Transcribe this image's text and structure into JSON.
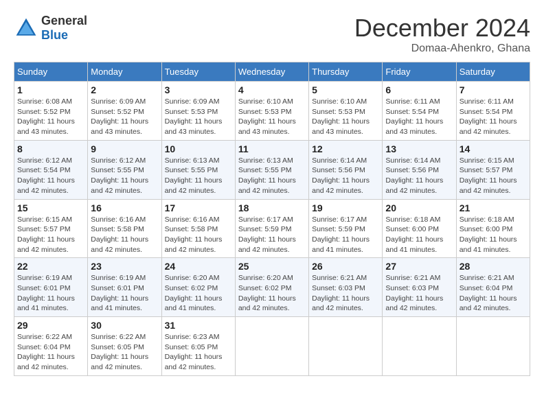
{
  "logo": {
    "general": "General",
    "blue": "Blue"
  },
  "title": "December 2024",
  "location": "Domaa-Ahenkro, Ghana",
  "days_of_week": [
    "Sunday",
    "Monday",
    "Tuesday",
    "Wednesday",
    "Thursday",
    "Friday",
    "Saturday"
  ],
  "weeks": [
    [
      {
        "day": "1",
        "sunrise": "6:08 AM",
        "sunset": "5:52 PM",
        "daylight": "11 hours and 43 minutes."
      },
      {
        "day": "2",
        "sunrise": "6:09 AM",
        "sunset": "5:52 PM",
        "daylight": "11 hours and 43 minutes."
      },
      {
        "day": "3",
        "sunrise": "6:09 AM",
        "sunset": "5:53 PM",
        "daylight": "11 hours and 43 minutes."
      },
      {
        "day": "4",
        "sunrise": "6:10 AM",
        "sunset": "5:53 PM",
        "daylight": "11 hours and 43 minutes."
      },
      {
        "day": "5",
        "sunrise": "6:10 AM",
        "sunset": "5:53 PM",
        "daylight": "11 hours and 43 minutes."
      },
      {
        "day": "6",
        "sunrise": "6:11 AM",
        "sunset": "5:54 PM",
        "daylight": "11 hours and 43 minutes."
      },
      {
        "day": "7",
        "sunrise": "6:11 AM",
        "sunset": "5:54 PM",
        "daylight": "11 hours and 42 minutes."
      }
    ],
    [
      {
        "day": "8",
        "sunrise": "6:12 AM",
        "sunset": "5:54 PM",
        "daylight": "11 hours and 42 minutes."
      },
      {
        "day": "9",
        "sunrise": "6:12 AM",
        "sunset": "5:55 PM",
        "daylight": "11 hours and 42 minutes."
      },
      {
        "day": "10",
        "sunrise": "6:13 AM",
        "sunset": "5:55 PM",
        "daylight": "11 hours and 42 minutes."
      },
      {
        "day": "11",
        "sunrise": "6:13 AM",
        "sunset": "5:55 PM",
        "daylight": "11 hours and 42 minutes."
      },
      {
        "day": "12",
        "sunrise": "6:14 AM",
        "sunset": "5:56 PM",
        "daylight": "11 hours and 42 minutes."
      },
      {
        "day": "13",
        "sunrise": "6:14 AM",
        "sunset": "5:56 PM",
        "daylight": "11 hours and 42 minutes."
      },
      {
        "day": "14",
        "sunrise": "6:15 AM",
        "sunset": "5:57 PM",
        "daylight": "11 hours and 42 minutes."
      }
    ],
    [
      {
        "day": "15",
        "sunrise": "6:15 AM",
        "sunset": "5:57 PM",
        "daylight": "11 hours and 42 minutes."
      },
      {
        "day": "16",
        "sunrise": "6:16 AM",
        "sunset": "5:58 PM",
        "daylight": "11 hours and 42 minutes."
      },
      {
        "day": "17",
        "sunrise": "6:16 AM",
        "sunset": "5:58 PM",
        "daylight": "11 hours and 42 minutes."
      },
      {
        "day": "18",
        "sunrise": "6:17 AM",
        "sunset": "5:59 PM",
        "daylight": "11 hours and 42 minutes."
      },
      {
        "day": "19",
        "sunrise": "6:17 AM",
        "sunset": "5:59 PM",
        "daylight": "11 hours and 41 minutes."
      },
      {
        "day": "20",
        "sunrise": "6:18 AM",
        "sunset": "6:00 PM",
        "daylight": "11 hours and 41 minutes."
      },
      {
        "day": "21",
        "sunrise": "6:18 AM",
        "sunset": "6:00 PM",
        "daylight": "11 hours and 41 minutes."
      }
    ],
    [
      {
        "day": "22",
        "sunrise": "6:19 AM",
        "sunset": "6:01 PM",
        "daylight": "11 hours and 41 minutes."
      },
      {
        "day": "23",
        "sunrise": "6:19 AM",
        "sunset": "6:01 PM",
        "daylight": "11 hours and 41 minutes."
      },
      {
        "day": "24",
        "sunrise": "6:20 AM",
        "sunset": "6:02 PM",
        "daylight": "11 hours and 41 minutes."
      },
      {
        "day": "25",
        "sunrise": "6:20 AM",
        "sunset": "6:02 PM",
        "daylight": "11 hours and 42 minutes."
      },
      {
        "day": "26",
        "sunrise": "6:21 AM",
        "sunset": "6:03 PM",
        "daylight": "11 hours and 42 minutes."
      },
      {
        "day": "27",
        "sunrise": "6:21 AM",
        "sunset": "6:03 PM",
        "daylight": "11 hours and 42 minutes."
      },
      {
        "day": "28",
        "sunrise": "6:21 AM",
        "sunset": "6:04 PM",
        "daylight": "11 hours and 42 minutes."
      }
    ],
    [
      {
        "day": "29",
        "sunrise": "6:22 AM",
        "sunset": "6:04 PM",
        "daylight": "11 hours and 42 minutes."
      },
      {
        "day": "30",
        "sunrise": "6:22 AM",
        "sunset": "6:05 PM",
        "daylight": "11 hours and 42 minutes."
      },
      {
        "day": "31",
        "sunrise": "6:23 AM",
        "sunset": "6:05 PM",
        "daylight": "11 hours and 42 minutes."
      },
      null,
      null,
      null,
      null
    ]
  ],
  "labels": {
    "sunrise": "Sunrise: ",
    "sunset": "Sunset: ",
    "daylight": "Daylight: "
  }
}
